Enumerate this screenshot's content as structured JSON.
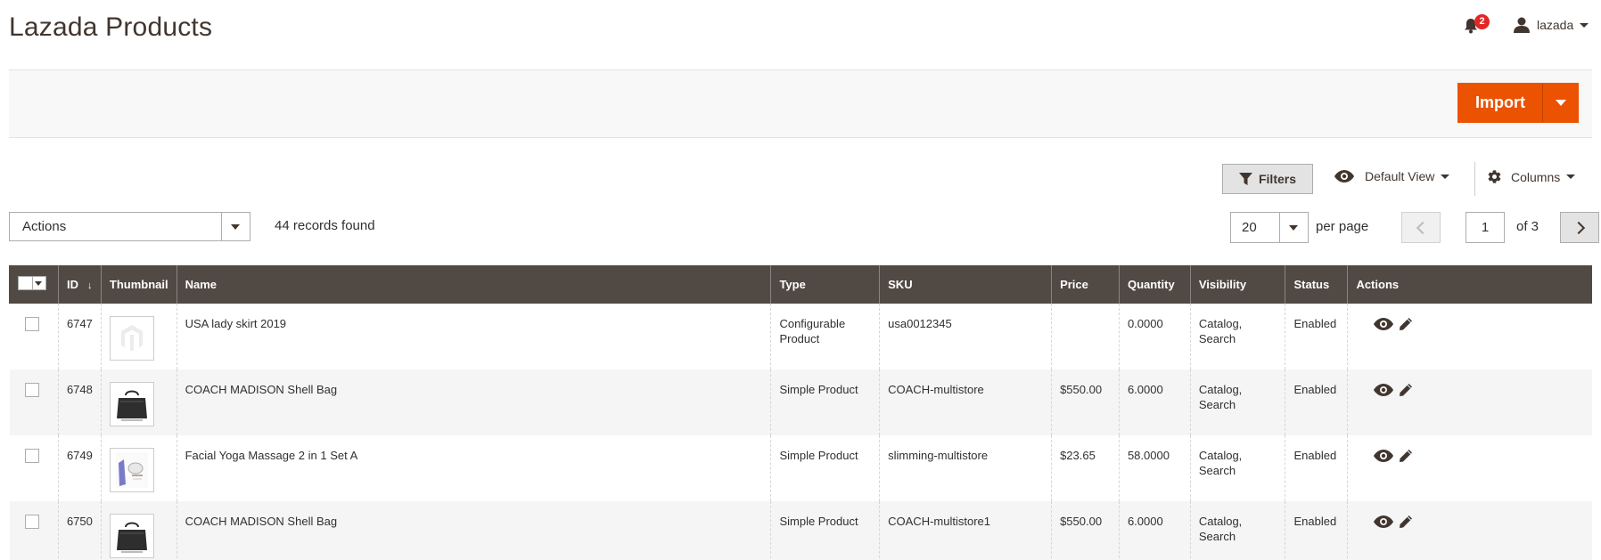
{
  "header": {
    "title": "Lazada Products",
    "notifications_count": "2",
    "user_name": "lazada"
  },
  "action_bar": {
    "import_label": "Import"
  },
  "toolbar": {
    "filters_label": "Filters",
    "view_label": "Default View",
    "columns_label": "Columns",
    "actions_value": "Actions",
    "records_found": "44 records found",
    "per_page_value": "20",
    "per_page_label": "per page",
    "current_page": "1",
    "page_of": "of 3"
  },
  "grid": {
    "columns": [
      "ID",
      "Thumbnail",
      "Name",
      "Type",
      "SKU",
      "Price",
      "Quantity",
      "Visibility",
      "Status",
      "Actions"
    ],
    "rows": [
      {
        "id": "6747",
        "thumb": "placeholder-logo",
        "name": "USA lady skirt 2019",
        "type": "Configurable Product",
        "sku": "usa0012345",
        "price": "",
        "quantity": "0.0000",
        "visibility": "Catalog, Search",
        "status": "Enabled"
      },
      {
        "id": "6748",
        "thumb": "black-bag",
        "name": "COACH MADISON Shell Bag",
        "type": "Simple Product",
        "sku": "COACH-multistore",
        "price": "$550.00",
        "quantity": "6.0000",
        "visibility": "Catalog, Search",
        "status": "Enabled"
      },
      {
        "id": "6749",
        "thumb": "massage-set",
        "name": "Facial Yoga Massage 2 in 1 Set A",
        "type": "Simple Product",
        "sku": "slimming-multistore",
        "price": "$23.65",
        "quantity": "58.0000",
        "visibility": "Catalog, Search",
        "status": "Enabled"
      },
      {
        "id": "6750",
        "thumb": "black-bag",
        "name": "COACH MADISON Shell Bag",
        "type": "Simple Product",
        "sku": "COACH-multistore1",
        "price": "$550.00",
        "quantity": "6.0000",
        "visibility": "Catalog, Search",
        "status": "Enabled"
      }
    ]
  },
  "icons": {
    "notifications": "bell-icon",
    "user": "user-icon",
    "filters": "funnel-icon",
    "view": "eye-icon",
    "columns": "gear-icon",
    "row_view": "eye-icon",
    "row_edit": "pencil-icon"
  },
  "colors": {
    "accent": "#eb5202",
    "grid_header": "#514943",
    "badge": "#e22626"
  }
}
